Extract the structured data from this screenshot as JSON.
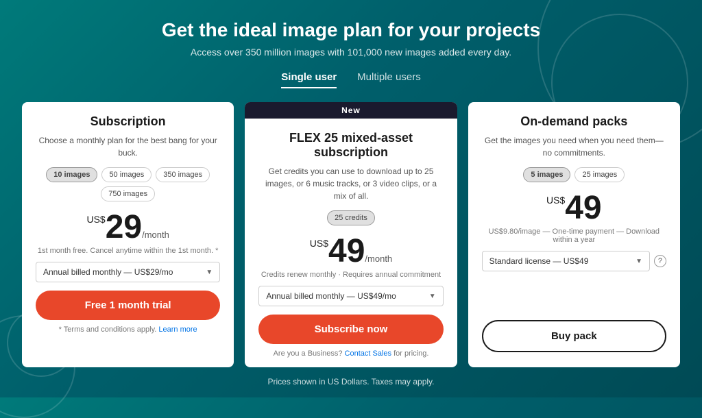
{
  "page": {
    "title": "Get the ideal image plan for your projects",
    "subtitle": "Access over 350 million images with 101,000 new images added every day.",
    "footer_note": "Prices shown in US Dollars. Taxes may apply."
  },
  "tabs": [
    {
      "label": "Single user",
      "active": true
    },
    {
      "label": "Multiple users",
      "active": false
    }
  ],
  "cards": [
    {
      "id": "subscription",
      "badge": null,
      "title": "Subscription",
      "description": "Choose a monthly plan for the best bang for your buck.",
      "options": [
        {
          "label": "10 images",
          "selected": true
        },
        {
          "label": "50 images",
          "selected": false
        },
        {
          "label": "350 images",
          "selected": false
        },
        {
          "label": "750 images",
          "selected": false
        }
      ],
      "price_currency": "US$",
      "price_amount": "29",
      "price_period": "/month",
      "price_note": "1st month free. Cancel anytime within the 1st month. *",
      "dropdown_label": "Annual billed monthly — US$29/mo",
      "cta_label": "Free 1 month trial",
      "cta_type": "primary",
      "terms": "* Terms and conditions apply.",
      "terms_link_label": "Learn more",
      "business_text": null
    },
    {
      "id": "flex",
      "badge": "New",
      "title": "FLEX 25 mixed-asset subscription",
      "description": "Get credits you can use to download up to 25 images, or 6 music tracks, or 3 video clips, or a mix of all.",
      "options": [
        {
          "label": "25 credits",
          "selected": true
        }
      ],
      "price_currency": "US$",
      "price_amount": "49",
      "price_period": "/month",
      "price_note": "Credits renew monthly · Requires annual commitment",
      "dropdown_label": "Annual billed monthly — US$49/mo",
      "cta_label": "Subscribe now",
      "cta_type": "primary",
      "terms": null,
      "terms_link_label": null,
      "business_text": "Are you a Business?",
      "business_link_label": "Contact Sales",
      "business_suffix": " for pricing."
    },
    {
      "id": "on-demand",
      "badge": null,
      "title": "On-demand packs",
      "description": "Get the images you need when you need them—no commitments.",
      "options": [
        {
          "label": "5 images",
          "selected": true
        },
        {
          "label": "25 images",
          "selected": false
        }
      ],
      "price_currency": "US$",
      "price_amount": "49",
      "price_period": "",
      "price_note": "US$9.80/image — One-time payment — Download within a year",
      "dropdown_label": "Standard license — US$49",
      "show_help": true,
      "cta_label": "Buy pack",
      "cta_type": "secondary",
      "terms": null,
      "terms_link_label": null,
      "business_text": null
    }
  ]
}
